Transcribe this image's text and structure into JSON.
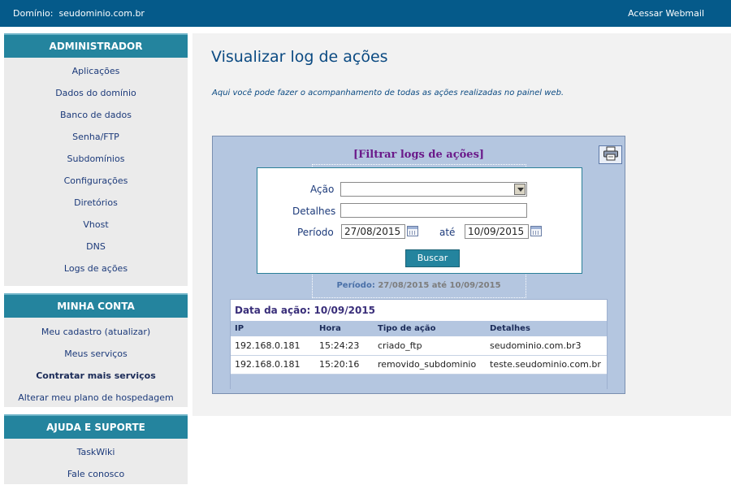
{
  "topbar": {
    "domain_label": "Domínio:",
    "domain_value": "seudominio.com.br",
    "webmail": "Acessar Webmail"
  },
  "sidebar": {
    "admin": {
      "title": "ADMINISTRADOR",
      "items": [
        "Aplicações",
        "Dados do domínio",
        "Banco de dados",
        "Senha/FTP",
        "Subdomínios",
        "Configurações",
        "Diretórios",
        "Vhost",
        "DNS",
        "Logs de ações"
      ]
    },
    "account": {
      "title": "MINHA CONTA",
      "items": [
        "Meu cadastro (atualizar)",
        "Meus serviços",
        "Contratar mais serviços",
        "Alterar meu plano de hospedagem"
      ]
    },
    "support": {
      "title": "AJUDA E SUPORTE",
      "items": [
        "TaskWiki",
        "Fale conosco"
      ]
    }
  },
  "main": {
    "title": "Visualizar log de ações",
    "description": "Aqui você pode fazer o acompanhamento de todas as ações realizadas no painel web.",
    "filter": {
      "title": "[Filtrar logs de ações]",
      "action_label": "Ação",
      "action_value": "",
      "details_label": "Detalhes",
      "details_value": "",
      "period_label": "Período",
      "period_from": "27/08/2015",
      "until_label": "até",
      "period_to": "10/09/2015",
      "search_button": "Buscar",
      "period_summary_label": "Período:",
      "period_summary_value": "27/08/2015 até 10/09/2015"
    },
    "results": {
      "date_heading": "Data da ação: 10/09/2015",
      "columns": [
        "IP",
        "Hora",
        "Tipo de ação",
        "Detalhes"
      ],
      "rows": [
        [
          "192.168.0.181",
          "15:24:23",
          "criado_ftp",
          "seudominio.com.br3"
        ],
        [
          "192.168.0.181",
          "15:20:16",
          "removido_subdominio",
          "teste.seudominio.com.br"
        ]
      ]
    }
  },
  "colors": {
    "topbar": "#055a8a",
    "section_header": "#24849e",
    "panel": "#b4c6e0",
    "title_text": "#0b4a82",
    "filter_title": "#6b1a8a"
  }
}
